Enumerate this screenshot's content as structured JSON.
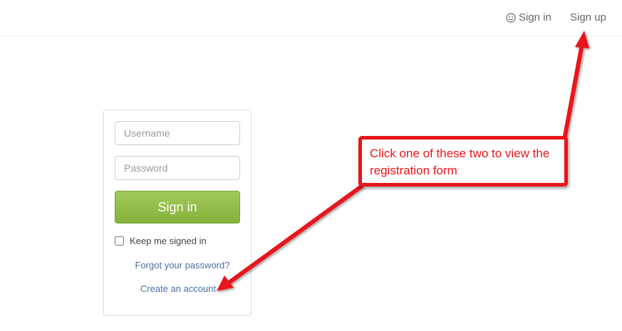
{
  "nav": {
    "signin_label": "Sign in",
    "signup_label": "Sign up"
  },
  "form": {
    "username_placeholder": "Username",
    "password_placeholder": "Password",
    "signin_button": "Sign in",
    "keep_signed_in_label": "Keep me signed in",
    "forgot_link": "Forgot your password?",
    "create_link": "Create an account"
  },
  "annotation": {
    "text": "Click one of these two to view the registration form"
  },
  "colors": {
    "accent_green": "#8ab741",
    "link_blue": "#4a6fa5",
    "annotation_red": "#e8141a"
  }
}
